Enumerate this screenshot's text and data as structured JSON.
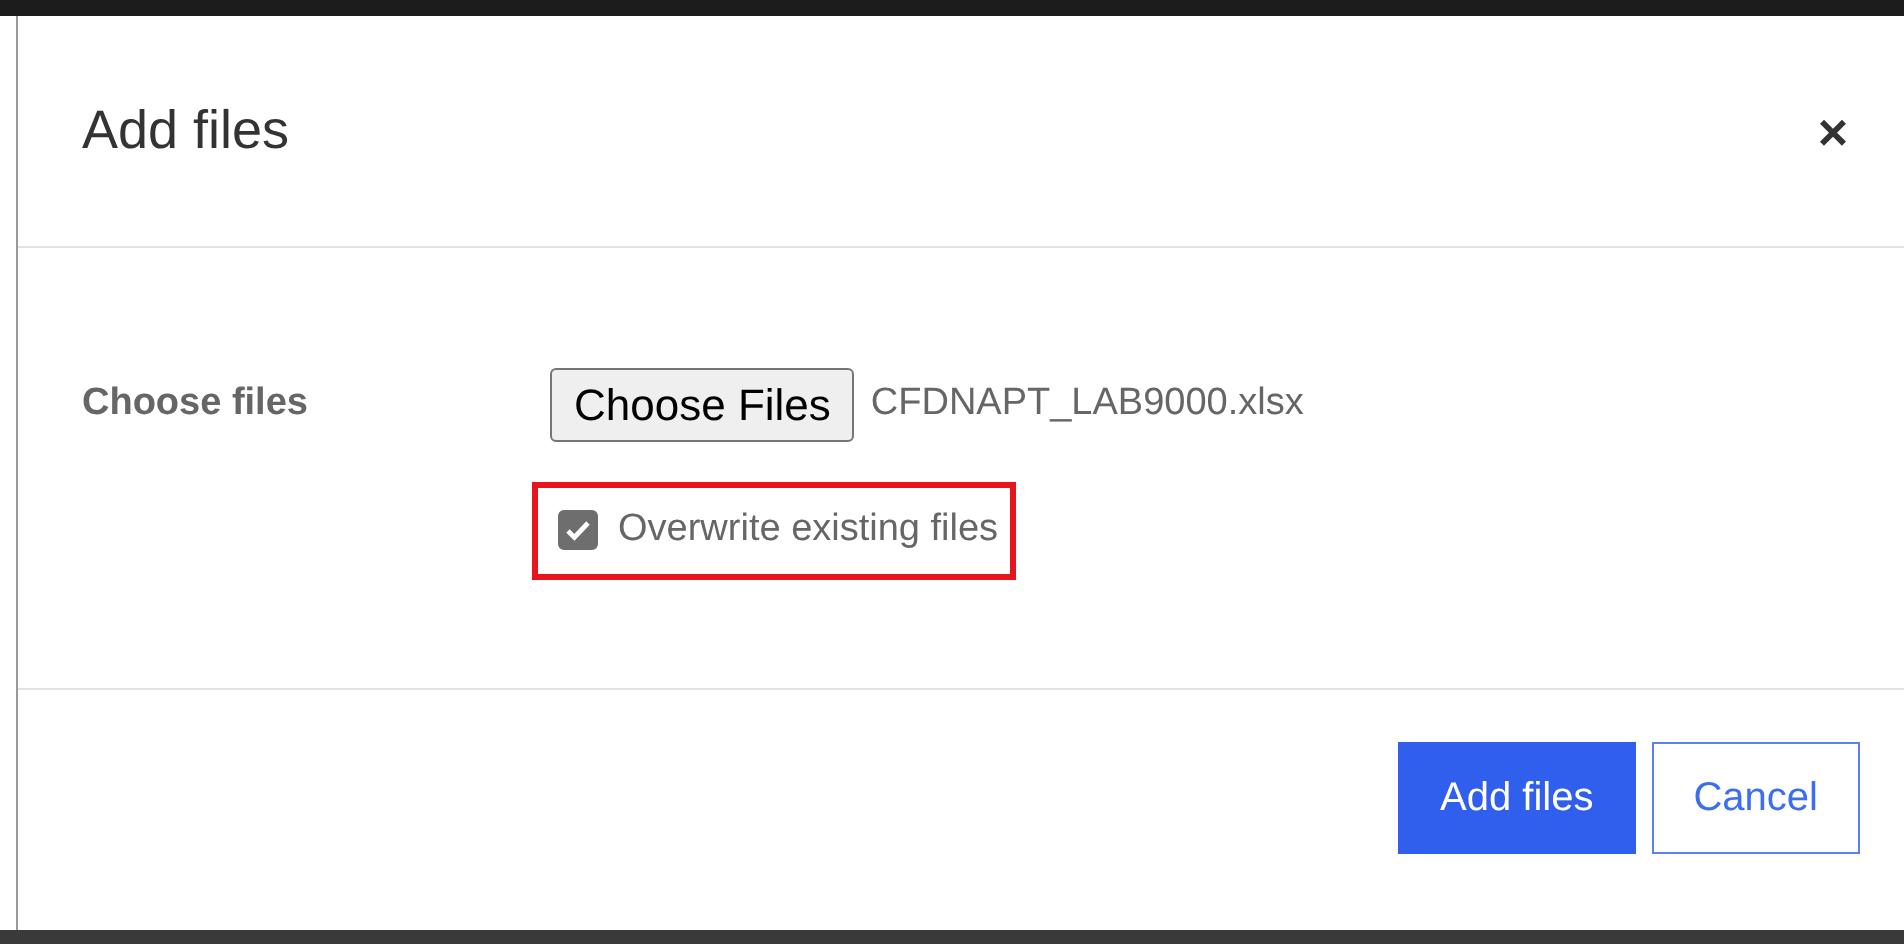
{
  "dialog": {
    "title": "Add files",
    "close": "×"
  },
  "form": {
    "label": "Choose files",
    "file_button": "Choose Files",
    "file_name": "CFDNAPT_LAB9000.xlsx",
    "overwrite": {
      "label": "Overwrite existing files",
      "checked": true,
      "highlighted": true
    }
  },
  "buttons": [
    {
      "label": "Add files",
      "kind": "primary"
    },
    {
      "label": "Cancel",
      "kind": "outline"
    }
  ]
}
